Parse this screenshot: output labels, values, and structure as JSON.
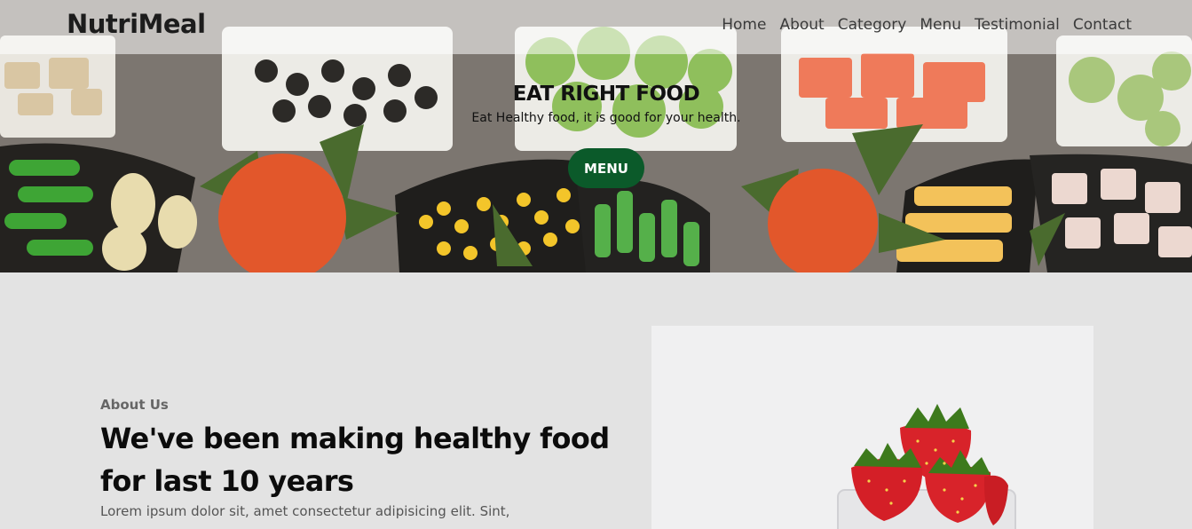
{
  "brand": {
    "logo": "NutriMeal"
  },
  "nav": {
    "items": [
      "Home",
      "About",
      "Category",
      "Menu",
      "Testimonial",
      "Contact"
    ]
  },
  "hero": {
    "title": "EAT RIGHT FOOD",
    "subtitle": "Eat Healthy food, it is good for your health.",
    "cta_label": "MENU"
  },
  "about": {
    "kicker": "About Us",
    "heading": "We've been making healthy food for last 10 years",
    "body": "Lorem ipsum dolor sit, amet consectetur adipisicing elit. Sint,"
  },
  "colors": {
    "accent": "#0b5a2a",
    "page_bg": "#e3e3e3"
  }
}
